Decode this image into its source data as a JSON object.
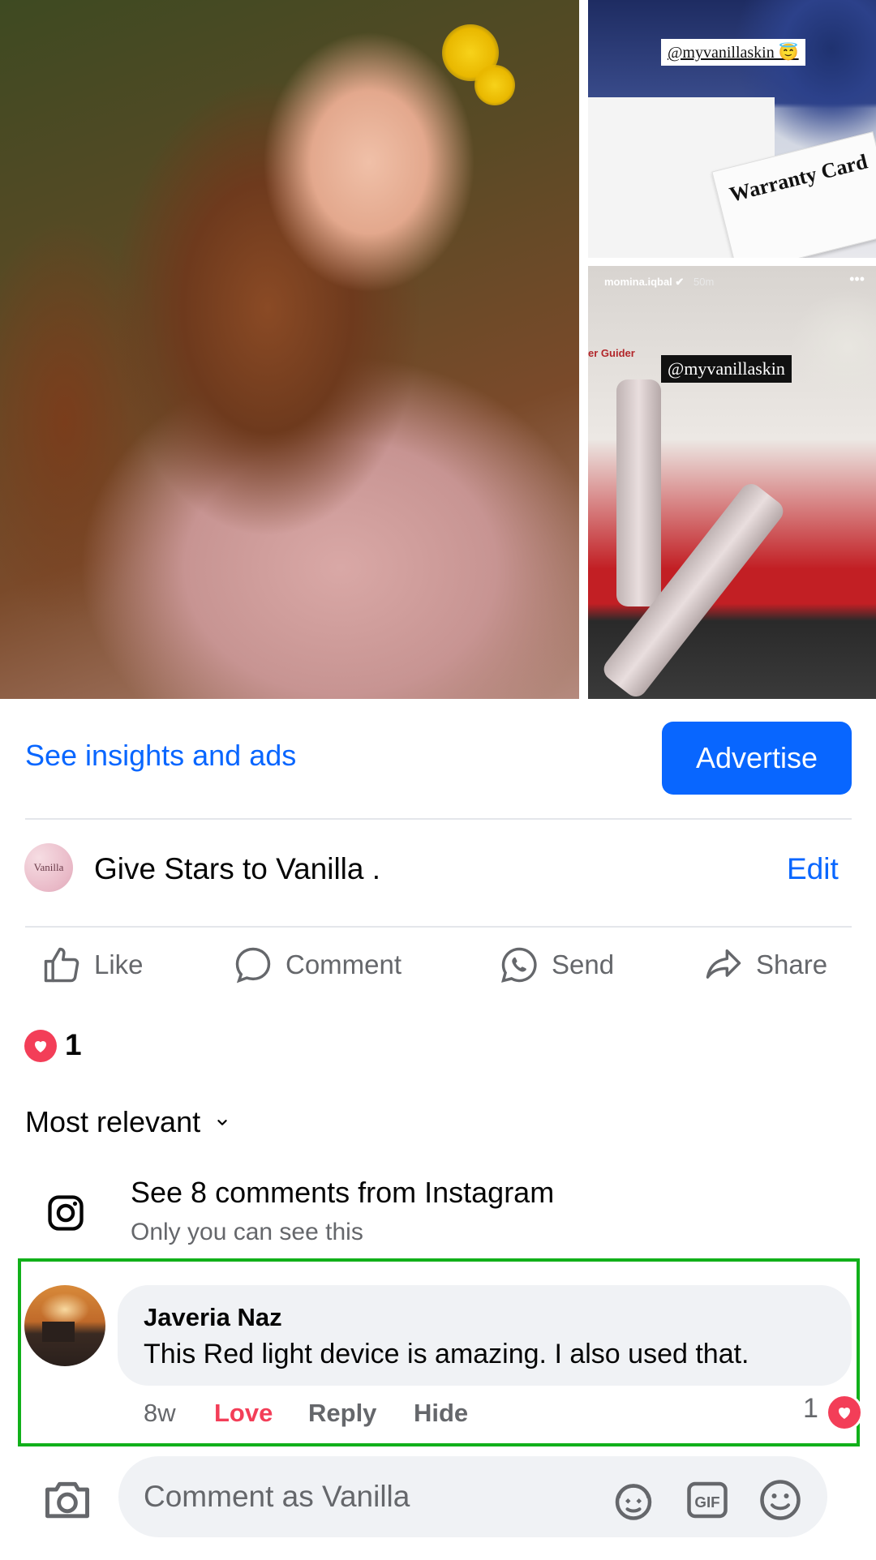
{
  "photos": {
    "top_right_tag": "@myvanillaskin 😇",
    "top_right_card_title": "Warranty Card",
    "bottom_right_user": "momina.iqbal ✔",
    "bottom_right_time": "50m",
    "bottom_right_tag": "@myvanillaskin",
    "bottom_right_guide": "er Guider"
  },
  "insights": {
    "link_label": "See insights and ads",
    "advertise_label": "Advertise"
  },
  "stars": {
    "avatar_text": "Vanilla",
    "text": "Give Stars to Vanilla .",
    "edit_label": "Edit"
  },
  "actions": {
    "like": "Like",
    "comment": "Comment",
    "send": "Send",
    "share": "Share"
  },
  "reactions": {
    "count": "1"
  },
  "sort": {
    "label": "Most relevant"
  },
  "instagram": {
    "title": "See 8 comments from Instagram",
    "subtitle": "Only you can see this"
  },
  "comment": {
    "author": "Javeria Naz",
    "text": "This Red light device is amazing. I also used that.",
    "time": "8w",
    "love_label": "Love",
    "reply_label": "Reply",
    "hide_label": "Hide",
    "reaction_count": "1"
  },
  "composer": {
    "placeholder": "Comment as Vanilla"
  },
  "colors": {
    "accent": "#0866ff",
    "love": "#f33e58",
    "highlight": "#11b01a"
  },
  "icons": [
    "like-icon",
    "comment-icon",
    "whatsapp-icon",
    "share-icon",
    "instagram-icon",
    "camera-icon",
    "avatar-sticker-icon",
    "gif-icon",
    "emoji-icon",
    "heart-icon",
    "chevron-down-icon"
  ]
}
